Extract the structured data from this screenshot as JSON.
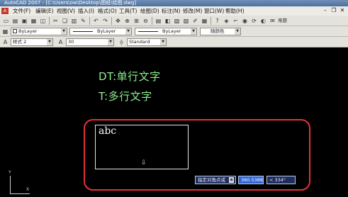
{
  "window": {
    "title": "AutoCAD 2007 - [C:\\Users\\ow\\Desktop\\图纸\\绘图.dwg]"
  },
  "menubar": {
    "app_icon": "A",
    "items": [
      "文件(F)",
      "编辑(E)",
      "视图(V)",
      "插入(I)",
      "格式(O)",
      "工具(T)",
      "绘图(D)",
      "标注(N)",
      "修改(M)",
      "窗口(W)",
      "帮助(H)"
    ],
    "controls": [
      "–",
      "❐",
      "✕"
    ]
  },
  "toolbar1": {
    "share_label": "帛旅"
  },
  "toolbar2": {
    "layer_combo": "ByLayer",
    "linetype_combo": "ByLayer",
    "lineweight_combo": "ByLayer",
    "color_combo": "随颜色"
  },
  "toolbar3": {
    "style_combo": "样式 2",
    "height_combo": "30",
    "font_combo": "Standard"
  },
  "annotations": {
    "line1": "DT:单行文字",
    "line2": "T:多行文字"
  },
  "mtext": {
    "content": "abc",
    "cursor_icon": "⇩"
  },
  "tooltips": {
    "prompt": "指定对角点或",
    "lock_icon": "▣",
    "value": "360.5388",
    "angle": "< 334°"
  },
  "ucs": {
    "x_label": "X",
    "y_label": "Y"
  },
  "colors": {
    "annotation_text": "#8ef08e",
    "highlight_border": "#e8303a",
    "tooltip_bg": "#1f2c5e",
    "value_bg": "#2f63d8",
    "canvas": "#000000"
  }
}
